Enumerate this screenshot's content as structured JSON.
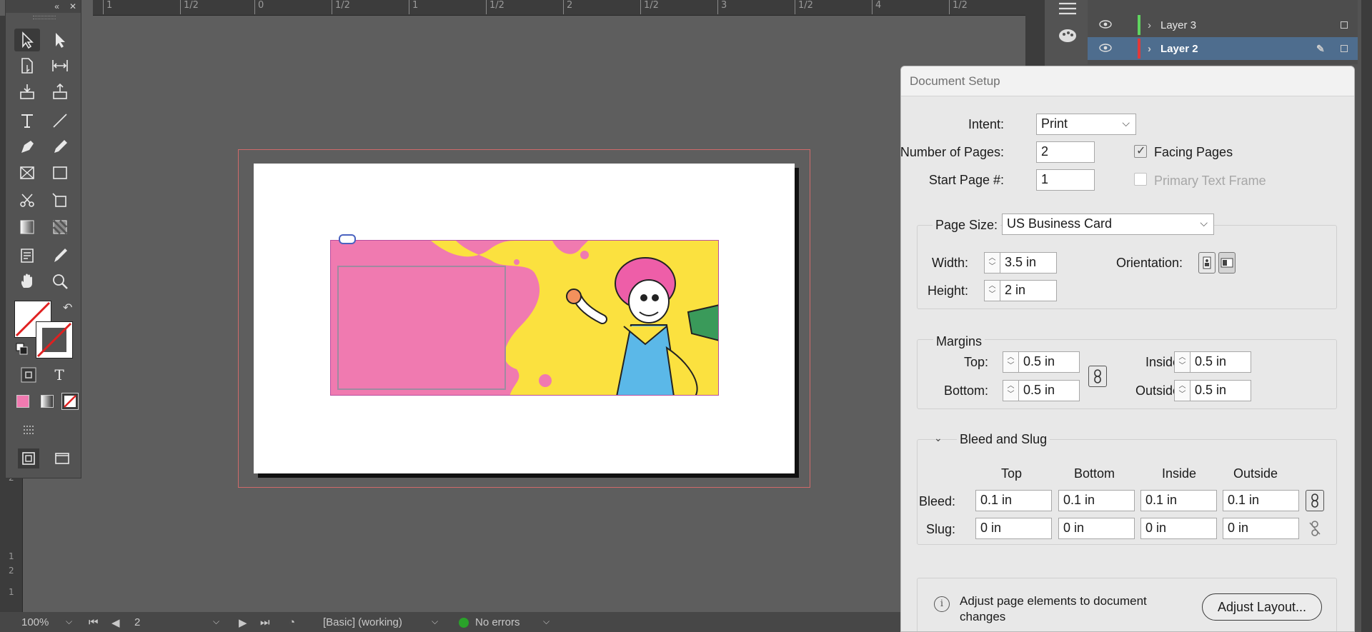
{
  "ruler": {
    "ticks": [
      "1",
      "1/2",
      "0",
      "1/2",
      "1",
      "1/2",
      "2",
      "1/2",
      "3",
      "1/2",
      "4",
      "1/2"
    ],
    "left_ticks": [
      "1",
      "2",
      "1",
      "2"
    ]
  },
  "layers": {
    "rows": [
      {
        "name": "Layer 3",
        "color": "#5fd45f",
        "active": false
      },
      {
        "name": "Layer 2",
        "color": "#e03a3a",
        "active": true
      }
    ]
  },
  "dialog": {
    "title": "Document Setup",
    "intent_label": "Intent:",
    "intent_value": "Print",
    "num_pages_label": "Number of Pages:",
    "num_pages_value": "2",
    "start_page_label": "Start Page #:",
    "start_page_value": "1",
    "facing_pages_label": "Facing Pages",
    "facing_pages_checked": true,
    "primary_text_frame_label": "Primary Text Frame",
    "primary_text_frame_checked": false,
    "page_size_label": "Page Size:",
    "page_size_value": "US Business Card",
    "width_label": "Width:",
    "width_value": "3.5 in",
    "height_label": "Height:",
    "height_value": "2 in",
    "orientation_label": "Orientation:",
    "margins": {
      "title": "Margins",
      "top_label": "Top:",
      "top_value": "0.5 in",
      "bottom_label": "Bottom:",
      "bottom_value": "0.5 in",
      "inside_label": "Inside:",
      "inside_value": "0.5 in",
      "outside_label": "Outside:",
      "outside_value": "0.5 in"
    },
    "bleed_slug": {
      "title": "Bleed and Slug",
      "col_top": "Top",
      "col_bottom": "Bottom",
      "col_inside": "Inside",
      "col_outside": "Outside",
      "bleed_label": "Bleed:",
      "bleed_values": [
        "0.1 in",
        "0.1 in",
        "0.1 in",
        "0.1 in"
      ],
      "slug_label": "Slug:",
      "slug_values": [
        "0 in",
        "0 in",
        "0 in",
        "0 in"
      ]
    },
    "adjust_text": "Adjust page elements to document changes",
    "adjust_button": "Adjust Layout..."
  },
  "statusbar": {
    "zoom": "100%",
    "page": "2",
    "preflight_profile": "[Basic] (working)",
    "errors": "No errors"
  },
  "colors": {
    "fill_swatch": "#f07ab0",
    "error_dot": "#2aa22a"
  }
}
